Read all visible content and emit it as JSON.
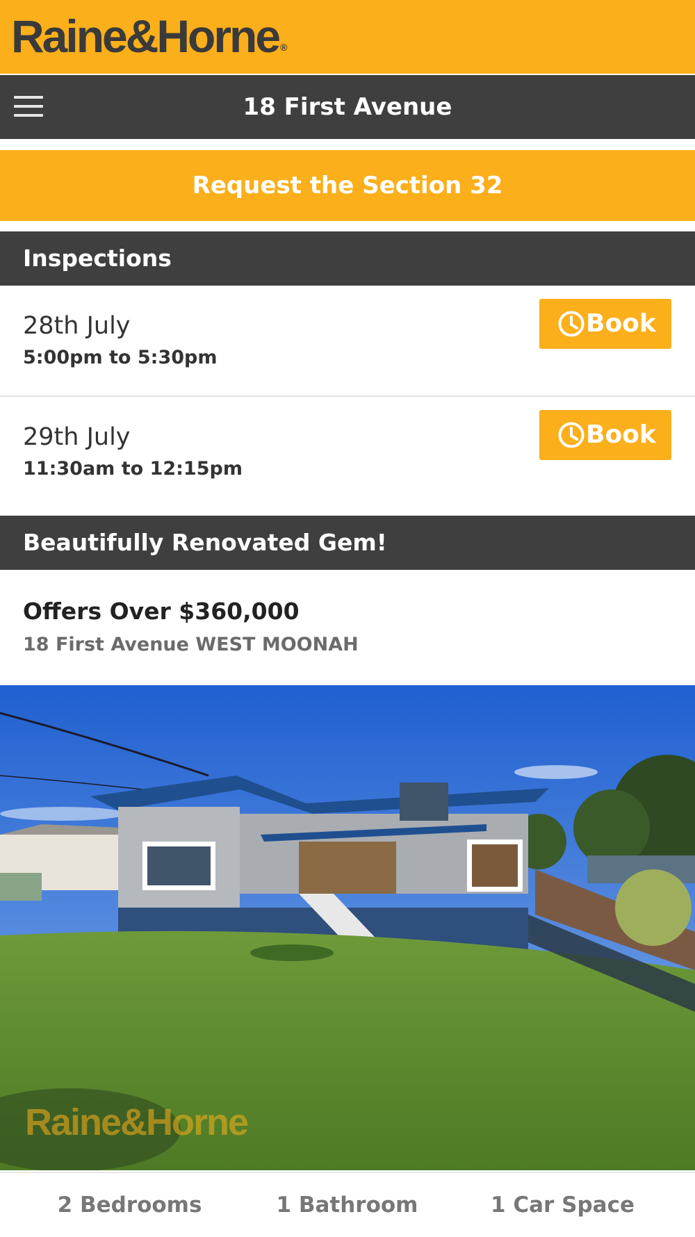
{
  "brand": {
    "logo_text": "Raine&Horne",
    "reg_mark": "®"
  },
  "nav": {
    "title": "18 First Avenue",
    "menu_icon": "hamburger-menu-icon"
  },
  "section32_button": {
    "label": "Request the Section 32"
  },
  "inspections": {
    "heading": "Inspections",
    "items": [
      {
        "date": "28th July",
        "time": "5:00pm to 5:30pm",
        "book_label": "Book",
        "icon": "clock-icon"
      },
      {
        "date": "29th July",
        "time": "11:30am to 12:15pm",
        "book_label": "Book",
        "icon": "clock-icon"
      }
    ]
  },
  "listing": {
    "headline": "Beautifully Renovated Gem!",
    "price": "Offers Over $360,000",
    "address": "18 First Avenue WEST MOONAH",
    "photo_watermark": "Raine&Horne"
  },
  "features": [
    {
      "label": "2 Bedrooms"
    },
    {
      "label": "1 Bathroom"
    },
    {
      "label": "1 Car Space"
    }
  ],
  "colors": {
    "accent": "#fbaf1b",
    "dark_bar": "#3f3f3f",
    "logo_text": "#3a3a3a"
  }
}
